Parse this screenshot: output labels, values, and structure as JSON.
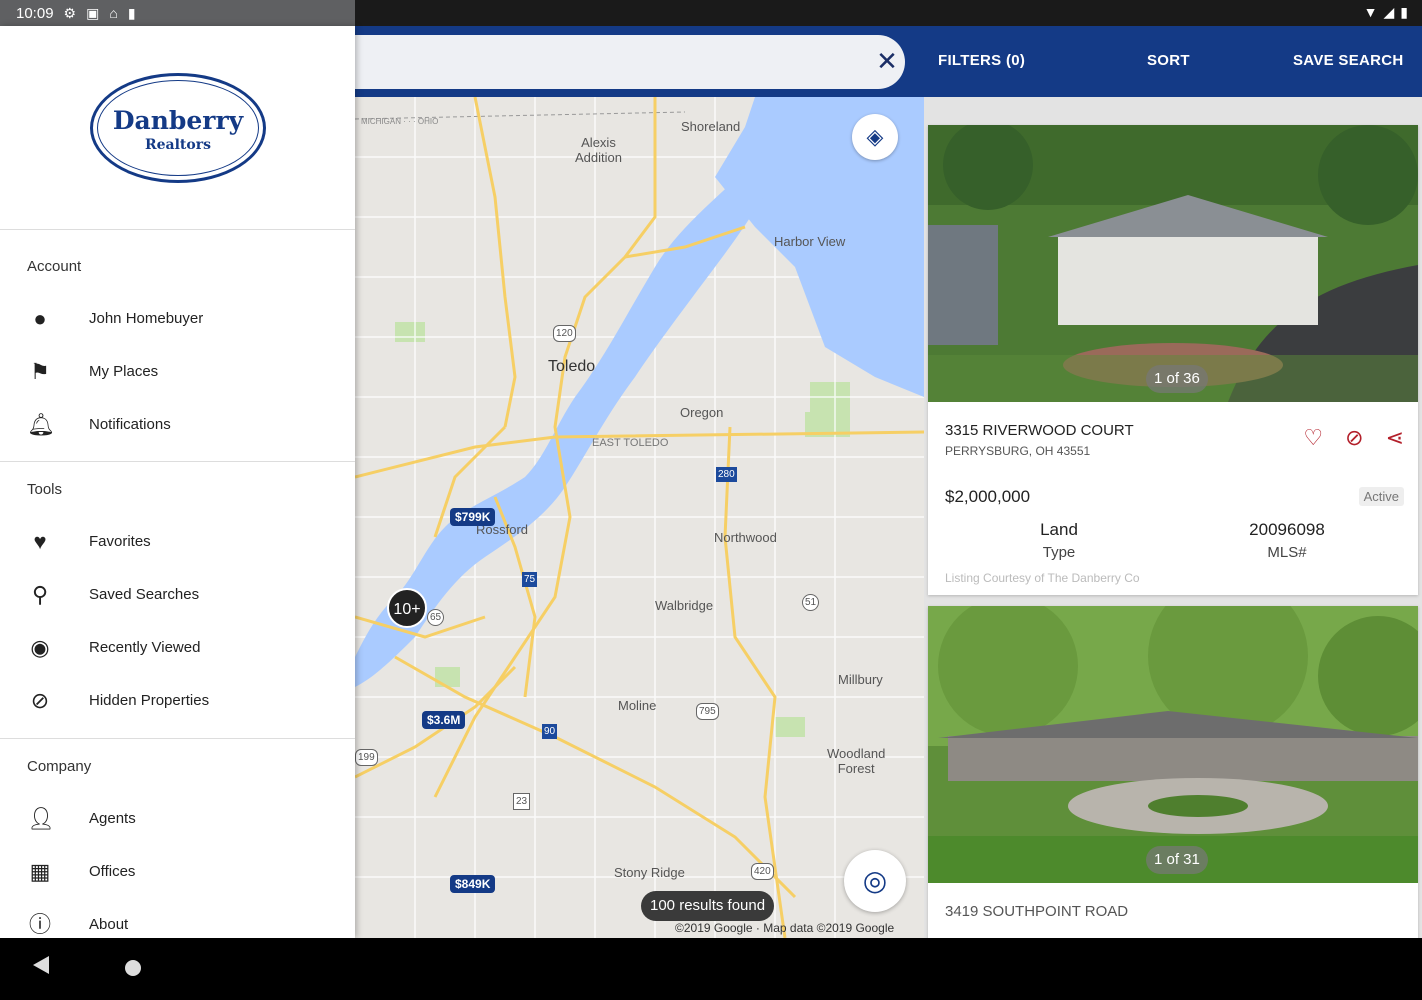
{
  "status_bar": {
    "time": "10:09"
  },
  "app_bar": {
    "filters_label": "FILTERS (0)",
    "sort_label": "SORT",
    "save_search_label": "SAVE SEARCH",
    "clear_glyph": "✕"
  },
  "drawer": {
    "logo": {
      "name": "Danberry",
      "sub": "Realtors"
    },
    "sections": {
      "account": "Account",
      "tools": "Tools",
      "company": "Company"
    },
    "account_items": [
      {
        "label": "John Homebuyer",
        "icon": "account-circle-icon"
      },
      {
        "label": "My Places",
        "icon": "flag-icon"
      },
      {
        "label": "Notifications",
        "icon": "bell-icon"
      }
    ],
    "tools_items": [
      {
        "label": "Favorites",
        "icon": "heart-icon"
      },
      {
        "label": "Saved Searches",
        "icon": "search-icon"
      },
      {
        "label": "Recently Viewed",
        "icon": "eye-icon"
      },
      {
        "label": "Hidden Properties",
        "icon": "eye-off-icon"
      }
    ],
    "company_items": [
      {
        "label": "Agents",
        "icon": "person-icon"
      },
      {
        "label": "Offices",
        "icon": "building-icon"
      },
      {
        "label": "About",
        "icon": "info-icon"
      }
    ]
  },
  "map": {
    "labels": {
      "shoreland": "Shoreland",
      "alexis": "Alexis\nAddition",
      "harbor_view": "Harbor View",
      "toledo": "Toledo",
      "oregon": "Oregon",
      "east_toledo": "EAST TOLEDO",
      "rossford": "Rossford",
      "northwood": "Northwood",
      "walbridge": "Walbridge",
      "millbury": "Millbury",
      "moline": "Moline",
      "woodland_forest": "Woodland\nForest",
      "stony_ridge": "Stony Ridge",
      "michigan_ohio": "MICHIGAN · · · OHIO"
    },
    "route_shields": [
      "120",
      "280",
      "75",
      "51",
      "65",
      "795",
      "90",
      "199",
      "23",
      "420"
    ],
    "price_pins": [
      "$799K",
      "$3.6M",
      "$849K"
    ],
    "cluster_label": "10+",
    "results_found": "100 results found",
    "attribution": "©2019 Google · Map data ©2019 Google"
  },
  "listings": [
    {
      "photo_count": "1 of 36",
      "address": "3315 RIVERWOOD COURT",
      "city": "PERRYSBURG, OH 43551",
      "price": "$2,000,000",
      "status": "Active",
      "type_value": "Land",
      "type_label": "Type",
      "mls_value": "20096098",
      "mls_label": "MLS#",
      "courtesy": "Listing Courtesy of The Danberry Co"
    },
    {
      "photo_count": "1 of 31",
      "address": "3419 SOUTHPOINT ROAD"
    }
  ]
}
